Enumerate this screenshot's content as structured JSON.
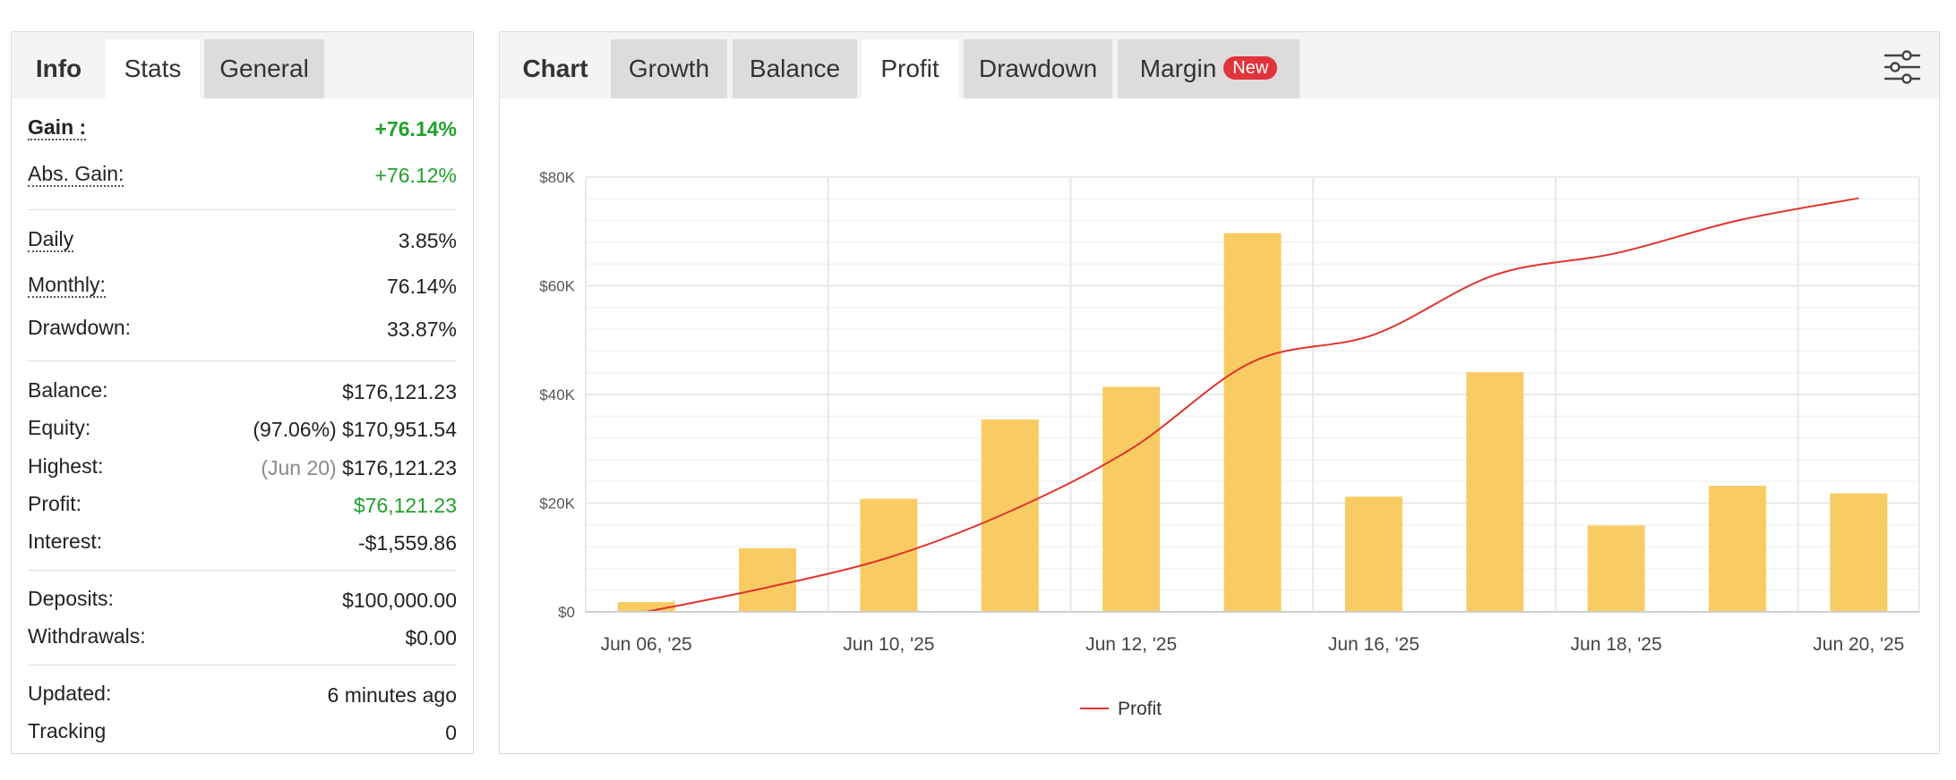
{
  "left_panel": {
    "tabs": [
      {
        "label": "Info",
        "state": "plain"
      },
      {
        "label": "Stats",
        "state": "active"
      },
      {
        "label": "General",
        "state": "grey"
      }
    ],
    "gain": {
      "label": "Gain :",
      "value": "+76.14%"
    },
    "abs_gain": {
      "label": "Abs. Gain:",
      "value": "+76.12%"
    },
    "daily": {
      "label": "Daily",
      "value": "3.85%"
    },
    "monthly": {
      "label": "Monthly:",
      "value": "76.14%"
    },
    "drawdown": {
      "label": "Drawdown:",
      "value": "33.87%"
    },
    "balance": {
      "label": "Balance:",
      "value": "$176,121.23"
    },
    "equity": {
      "label": "Equity:",
      "note": "(97.06%)",
      "value": "$170,951.54"
    },
    "highest": {
      "label": "Highest:",
      "note": "(Jun 20)",
      "value": "$176,121.23"
    },
    "profit": {
      "label": "Profit:",
      "value": "$76,121.23"
    },
    "interest": {
      "label": "Interest:",
      "value": "-$1,559.86"
    },
    "deposits": {
      "label": "Deposits:",
      "value": "$100,000.00"
    },
    "withdrawals": {
      "label": "Withdrawals:",
      "value": "$0.00"
    },
    "updated": {
      "label": "Updated:",
      "value": "6 minutes ago"
    },
    "tracking": {
      "label": "Tracking",
      "value": "0"
    }
  },
  "right_panel": {
    "tabs": [
      {
        "label": "Chart",
        "state": "plain"
      },
      {
        "label": "Growth",
        "state": "grey"
      },
      {
        "label": "Balance",
        "state": "grey"
      },
      {
        "label": "Profit",
        "state": "active"
      },
      {
        "label": "Drawdown",
        "state": "grey"
      },
      {
        "label": "Margin",
        "state": "grey",
        "badge": "New"
      }
    ],
    "settings_icon": "sliders-icon"
  },
  "colors": {
    "gain_green": "#1fa12c",
    "bar_fill": "#f8cc63",
    "line": "#e0342c",
    "badge": "#e0343c"
  },
  "chart_data": {
    "type": "bar",
    "y_ticks": [
      "$0",
      "$20K",
      "$40K",
      "$60K",
      "$80K"
    ],
    "ylim": [
      0,
      80000
    ],
    "x_ticks": [
      "Jun 06, '25",
      "Jun 10, '25",
      "Jun 12, '25",
      "Jun 16, '25",
      "Jun 18, '25",
      "Jun 20, '25"
    ],
    "bars": [
      1800,
      11700,
      20800,
      35400,
      41400,
      69700,
      21200,
      44100,
      15900,
      23200,
      21800
    ],
    "series": [
      {
        "name": "Profit",
        "type": "line",
        "values": [
          0,
          4500,
          10000,
          18500,
          30000,
          46000,
          51000,
          62000,
          66000,
          72000,
          76121
        ]
      }
    ],
    "legend": {
      "position": "bottom-center"
    },
    "grid": true
  }
}
